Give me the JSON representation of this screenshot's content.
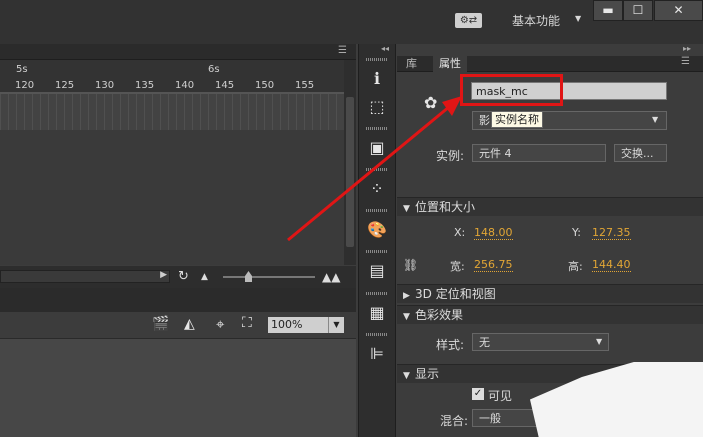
{
  "topbar": {
    "workspace_label": "基本功能",
    "switcher_icon": "workspace-switcher-icon",
    "minimize": "▬",
    "maximize": "☐",
    "close": "✕"
  },
  "timeline": {
    "seconds": [
      "5s",
      "6s"
    ],
    "ticks": [
      "120",
      "125",
      "130",
      "135",
      "140",
      "145",
      "150",
      "155"
    ]
  },
  "stage": {
    "zoom": "100%"
  },
  "properties": {
    "tabs": [
      "库",
      "属性"
    ],
    "instance_name": "mask_mc",
    "type_select_visible": "影",
    "tooltip": "实例名称",
    "instance_label": "实例:",
    "instance_of": "元件 4",
    "swap_button": "交换...",
    "sections": {
      "position_size": "位置和大小",
      "transform_3d": "3D 定位和视图",
      "color_effect": "色彩效果",
      "display": "显示"
    },
    "x_label": "X:",
    "x_value": "148.00",
    "y_label": "Y:",
    "y_value": "127.35",
    "w_label": "宽:",
    "w_value": "256.75",
    "h_label": "高:",
    "h_value": "144.40",
    "style_label": "样式:",
    "style_value": "无",
    "visible_label": "可见",
    "blend_label": "混合:",
    "blend_value": "一般"
  }
}
